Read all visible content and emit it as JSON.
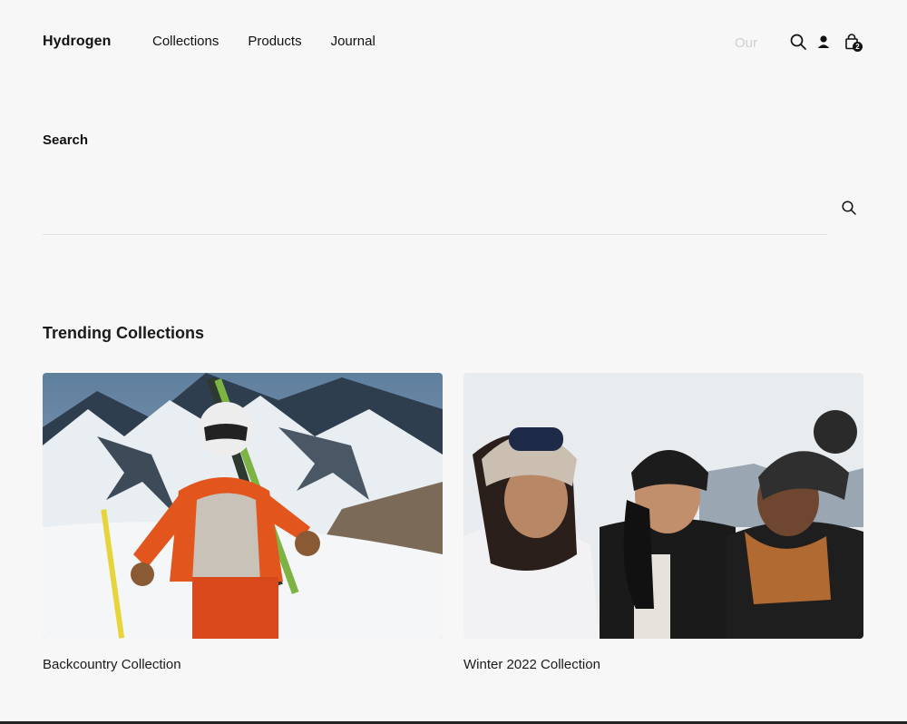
{
  "header": {
    "logo": "Hydrogen",
    "nav": [
      "Collections",
      "Products",
      "Journal"
    ],
    "search_hint": "Our",
    "cart_count": "2",
    "icons": [
      "search-icon",
      "account-icon",
      "cart-icon"
    ]
  },
  "search": {
    "title": "Search",
    "input_value": ""
  },
  "trending": {
    "title": "Trending Collections",
    "collections": [
      {
        "title": "Backcountry Collection"
      },
      {
        "title": "Winter 2022 Collection"
      }
    ]
  },
  "colors": {
    "background": "#f7f7f7",
    "text": "#1e1e1e",
    "rule": "#e3e3dc"
  }
}
